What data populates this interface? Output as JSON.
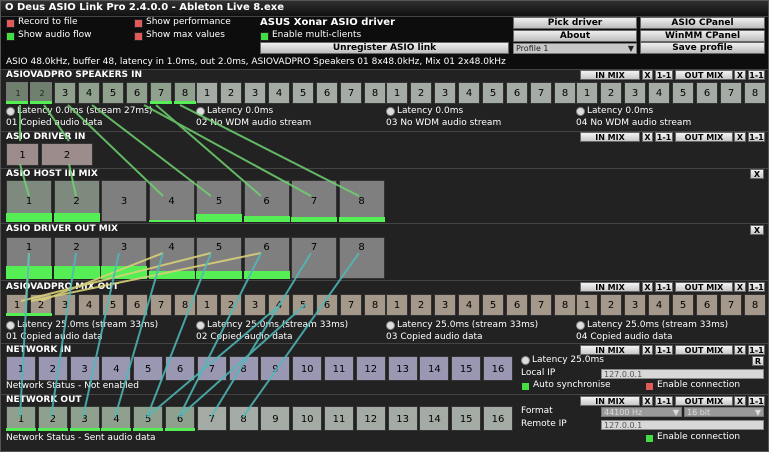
{
  "window": {
    "title": "O Deus ASIO Link Pro 2.4.0.0 - Ableton Live 8.exe"
  },
  "options": {
    "record_to_file": "Record to file",
    "show_performance": "Show performance",
    "show_audio_flow": "Show audio flow",
    "show_max_values": "Show max values",
    "asio_driver_name": "ASUS Xonar ASIO driver",
    "enable_multi_clients": "Enable multi-clients",
    "unregister": "Unregister ASIO link"
  },
  "buttons": {
    "pick_driver": "Pick driver",
    "asio_cpanel": "ASIO CPanel",
    "about": "About",
    "winmm_cpanel": "WinMM CPanel",
    "profile": "Profile 1",
    "save_profile": "Save profile"
  },
  "status_line": "ASIO 48.0kHz, buffer 48, latency in 1.0ms, out 2.0ms, ASIOVADPRO Speakers 01 8x48.0kHz, Mix 01 2x48.0kHz",
  "common": {
    "in_mix": "IN MIX",
    "x": "X",
    "one_one": "1-1",
    "out_mix": "OUT MIX",
    "r": "R"
  },
  "channels8": [
    "1",
    "2",
    "3",
    "4",
    "5",
    "6",
    "7",
    "8"
  ],
  "channels2": [
    "1",
    "2"
  ],
  "channels16": [
    "1",
    "2",
    "3",
    "4",
    "5",
    "6",
    "7",
    "8",
    "9",
    "10",
    "11",
    "12",
    "13",
    "14",
    "15",
    "16"
  ],
  "speakers_in": {
    "title": "ASIOVADPRO SPEAKERS IN",
    "groups": [
      {
        "latency": "Latency 0.0ms (stream 27ms)",
        "status": "01 Copied audio data"
      },
      {
        "latency": "Latency 0.0ms",
        "status": "02 No WDM audio stream"
      },
      {
        "latency": "Latency 0.0ms",
        "status": "03 No WDM audio stream"
      },
      {
        "latency": "Latency 0.0ms",
        "status": "04 No WDM audio stream"
      }
    ]
  },
  "driver_in": {
    "title": "ASIO DRIVER IN"
  },
  "host_in_mix": {
    "title": "ASIO HOST IN MIX",
    "levels": [
      0.22,
      0.22,
      0,
      0.05,
      0.2,
      0.15,
      0.12,
      0.12
    ]
  },
  "driver_out_mix": {
    "title": "ASIO DRIVER OUT MIX",
    "levels": [
      0.3,
      0.3,
      0.3,
      0.2,
      0.2,
      0.2,
      0,
      0
    ]
  },
  "mix_out": {
    "title": "ASIOVADPRO MIX OUT",
    "groups": [
      {
        "latency": "Latency 25.0ms (stream 33ms)",
        "status": "01 Copied audio data"
      },
      {
        "latency": "Latency 25.0ms (stream 33ms)",
        "status": "02 Copied audio data"
      },
      {
        "latency": "Latency 25.0ms (stream 33ms)",
        "status": "03 Copied audio data"
      },
      {
        "latency": "Latency 25.0ms (stream 33ms)",
        "status": "04 Copied audio data"
      }
    ]
  },
  "network_in": {
    "title": "NETWORK IN",
    "status": "Network Status - Not enabled",
    "latency": "Latency 25.0ms",
    "local_ip_label": "Local IP",
    "local_ip": "127.0.0.1",
    "auto_sync": "Auto synchronise",
    "enable_connection": "Enable connection"
  },
  "network_out": {
    "title": "NETWORK OUT",
    "status": "Network Status - Sent audio data",
    "format_label": "Format",
    "format_rate": "44100 Hz",
    "format_bits": "16 bit",
    "remote_ip_label": "Remote IP",
    "remote_ip": "127.0.0.1",
    "enable_connection": "Enable connection"
  },
  "colors": {
    "accent_green": "#55ee55",
    "flow_green": "#6fd36f",
    "flow_teal": "#4fb9b9",
    "flow_yellow": "#d8cf78"
  }
}
